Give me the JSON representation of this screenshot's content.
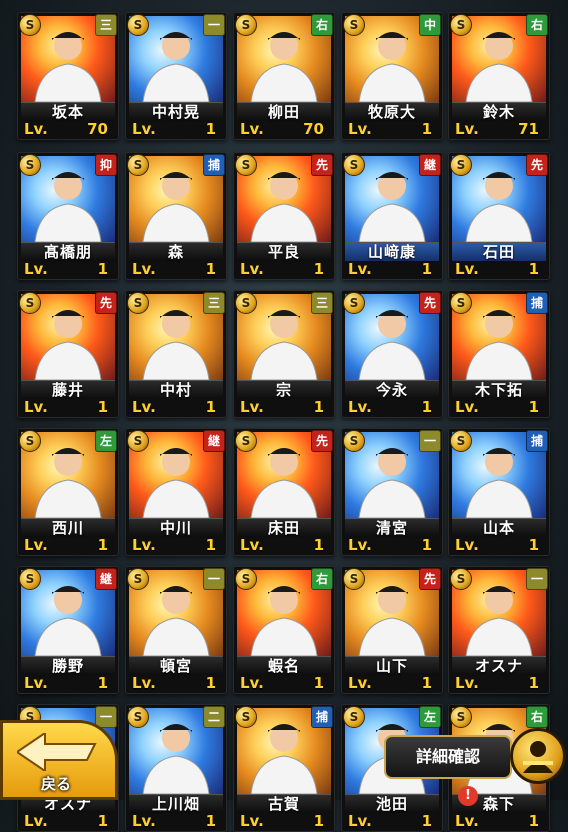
{
  "colors": {
    "pos_green": "#2f9a3a",
    "pos_olive": "#8c8a2a",
    "pos_red": "#c4231b",
    "pos_blue": "#1f5fb5",
    "level_text": "#ffcf2e",
    "gold": "#e0a21a"
  },
  "rank_badge_text": "S",
  "level_prefix": "Lv.",
  "cards": [
    {
      "name": "坂本",
      "level": "70",
      "pos": "三",
      "pos_color": "#8c8a2a",
      "art": "fire",
      "plate": "dark"
    },
    {
      "name": "中村晃",
      "level": "1",
      "pos": "一",
      "pos_color": "#8c8a2a",
      "art": "blue",
      "plate": "dark"
    },
    {
      "name": "柳田",
      "level": "70",
      "pos": "右",
      "pos_color": "#2f9a3a",
      "art": "gold",
      "plate": "dark"
    },
    {
      "name": "牧原大",
      "level": "1",
      "pos": "中",
      "pos_color": "#2f9a3a",
      "art": "gold",
      "plate": "dark"
    },
    {
      "name": "鈴木",
      "level": "71",
      "pos": "右",
      "pos_color": "#2f9a3a",
      "art": "fire",
      "plate": "dark"
    },
    {
      "name": "髙橋朋",
      "level": "1",
      "pos": "抑",
      "pos_color": "#c4231b",
      "art": "blue",
      "plate": "dark"
    },
    {
      "name": "森",
      "level": "1",
      "pos": "捕",
      "pos_color": "#1f5fb5",
      "art": "gold",
      "plate": "dark"
    },
    {
      "name": "平良",
      "level": "1",
      "pos": "先",
      "pos_color": "#c4231b",
      "art": "fire",
      "plate": "dark"
    },
    {
      "name": "山﨑康",
      "level": "1",
      "pos": "継",
      "pos_color": "#c4231b",
      "art": "blue",
      "plate": "blue"
    },
    {
      "name": "石田",
      "level": "1",
      "pos": "先",
      "pos_color": "#c4231b",
      "art": "blue",
      "plate": "blue"
    },
    {
      "name": "藤井",
      "level": "1",
      "pos": "先",
      "pos_color": "#c4231b",
      "art": "fire",
      "plate": "dark"
    },
    {
      "name": "中村",
      "level": "1",
      "pos": "三",
      "pos_color": "#8c8a2a",
      "art": "gold",
      "plate": "dark"
    },
    {
      "name": "宗",
      "level": "1",
      "pos": "三",
      "pos_color": "#8c8a2a",
      "art": "gold",
      "plate": "dark"
    },
    {
      "name": "今永",
      "level": "1",
      "pos": "先",
      "pos_color": "#c4231b",
      "art": "blue",
      "plate": "dark"
    },
    {
      "name": "木下拓",
      "level": "1",
      "pos": "捕",
      "pos_color": "#1f5fb5",
      "art": "fire",
      "plate": "dark"
    },
    {
      "name": "西川",
      "level": "1",
      "pos": "左",
      "pos_color": "#2f9a3a",
      "art": "gold",
      "plate": "dark"
    },
    {
      "name": "中川",
      "level": "1",
      "pos": "継",
      "pos_color": "#c4231b",
      "art": "fire",
      "plate": "dark"
    },
    {
      "name": "床田",
      "level": "1",
      "pos": "先",
      "pos_color": "#c4231b",
      "art": "fire",
      "plate": "dark"
    },
    {
      "name": "清宮",
      "level": "1",
      "pos": "一",
      "pos_color": "#8c8a2a",
      "art": "blue",
      "plate": "dark"
    },
    {
      "name": "山本",
      "level": "1",
      "pos": "捕",
      "pos_color": "#1f5fb5",
      "art": "blue",
      "plate": "dark"
    },
    {
      "name": "勝野",
      "level": "1",
      "pos": "継",
      "pos_color": "#c4231b",
      "art": "blue",
      "plate": "dark"
    },
    {
      "name": "頓宮",
      "level": "1",
      "pos": "一",
      "pos_color": "#8c8a2a",
      "art": "gold",
      "plate": "dark"
    },
    {
      "name": "蝦名",
      "level": "1",
      "pos": "右",
      "pos_color": "#2f9a3a",
      "art": "fire",
      "plate": "dark"
    },
    {
      "name": "山下",
      "level": "1",
      "pos": "先",
      "pos_color": "#c4231b",
      "art": "gold",
      "plate": "dark"
    },
    {
      "name": "オスナ",
      "level": "1",
      "pos": "一",
      "pos_color": "#8c8a2a",
      "art": "fire",
      "plate": "dark"
    },
    {
      "name": "オスナ",
      "level": "1",
      "pos": "一",
      "pos_color": "#8c8a2a",
      "art": "blue",
      "plate": "dark"
    },
    {
      "name": "上川畑",
      "level": "1",
      "pos": "二",
      "pos_color": "#8c8a2a",
      "art": "blue",
      "plate": "dark"
    },
    {
      "name": "古賀",
      "level": "1",
      "pos": "捕",
      "pos_color": "#1f5fb5",
      "art": "gold",
      "plate": "dark"
    },
    {
      "name": "池田",
      "level": "1",
      "pos": "左",
      "pos_color": "#2f9a3a",
      "art": "blue",
      "plate": "dark"
    },
    {
      "name": "森下",
      "level": "1",
      "pos": "右",
      "pos_color": "#2f9a3a",
      "art": "gold",
      "plate": "dark"
    }
  ],
  "back_button": {
    "label": "戻る"
  },
  "detail_button": {
    "label": "詳細確認"
  },
  "alert_badge": {
    "text": "!"
  }
}
